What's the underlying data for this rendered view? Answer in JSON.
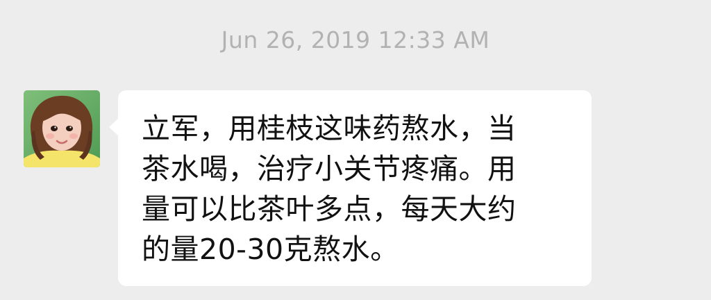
{
  "chat": {
    "timestamp": "Jun 26, 2019 12:33 AM",
    "message": {
      "text": "立军，用桂枝这味药熬水，当\n茶水喝，治疗小关节疼痛。用\n量可以比茶叶多点，每天大约\n的量20-30克熬水。",
      "avatar_icon": "child-portrait-avatar"
    }
  },
  "colors": {
    "background": "#ededed",
    "bubble": "#ffffff",
    "timestamp": "#b2b2b2",
    "text": "#111111"
  }
}
